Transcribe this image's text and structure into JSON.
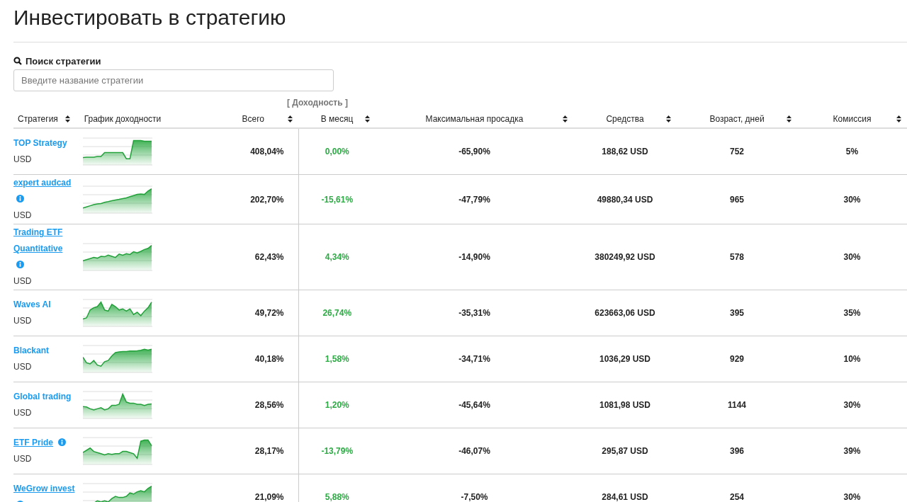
{
  "page_title": "Инвестировать в стратегию",
  "search": {
    "label": "Поиск стратегии",
    "placeholder": "Введите название стратегии"
  },
  "column_group": "[ Доходность ]",
  "columns": [
    {
      "label": "Стратегия",
      "sortable": true
    },
    {
      "label": "График доходности",
      "sortable": false
    },
    {
      "label": "Всего",
      "sortable": true
    },
    {
      "label": "В месяц",
      "sortable": true
    },
    {
      "label": "Максимальная просадка",
      "sortable": true
    },
    {
      "label": "Средства",
      "sortable": true
    },
    {
      "label": "Возраст, дней",
      "sortable": true
    },
    {
      "label": "Комиссия",
      "sortable": true
    }
  ],
  "rows": [
    {
      "name": "TOP Strategy",
      "info": false,
      "currency": "USD",
      "total": "408,04%",
      "monthly": "0,00%",
      "drawdown": "-65,90%",
      "funds": "188,62 USD",
      "age": "752",
      "commission": "5%"
    },
    {
      "name": "expert audcad",
      "info": true,
      "currency": "USD",
      "total": "202,70%",
      "monthly": "-15,61%",
      "drawdown": "-47,79%",
      "funds": "49880,34 USD",
      "age": "965",
      "commission": "30%"
    },
    {
      "name": "Trading ETF Quantitative",
      "info": true,
      "currency": "USD",
      "total": "62,43%",
      "monthly": "4,34%",
      "drawdown": "-14,90%",
      "funds": "380249,92 USD",
      "age": "578",
      "commission": "30%"
    },
    {
      "name": "Waves AI",
      "info": false,
      "currency": "USD",
      "total": "49,72%",
      "monthly": "26,74%",
      "drawdown": "-35,31%",
      "funds": "623663,06 USD",
      "age": "395",
      "commission": "35%"
    },
    {
      "name": "Blackant",
      "info": false,
      "currency": "USD",
      "total": "40,18%",
      "monthly": "1,58%",
      "drawdown": "-34,71%",
      "funds": "1036,29 USD",
      "age": "929",
      "commission": "10%"
    },
    {
      "name": "Global trading",
      "info": false,
      "currency": "USD",
      "total": "28,56%",
      "monthly": "1,20%",
      "drawdown": "-45,64%",
      "funds": "1081,98 USD",
      "age": "1144",
      "commission": "30%"
    },
    {
      "name": "ETF Pride",
      "info": true,
      "currency": "USD",
      "total": "28,17%",
      "monthly": "-13,79%",
      "drawdown": "-46,07%",
      "funds": "295,87 USD",
      "age": "396",
      "commission": "39%"
    },
    {
      "name": "WeGrow invest",
      "info": true,
      "total": "21,09%",
      "monthly": "5,88%",
      "drawdown": "-7,50%",
      "funds": "284,61 USD",
      "age": "254",
      "commission": "30%"
    }
  ]
}
